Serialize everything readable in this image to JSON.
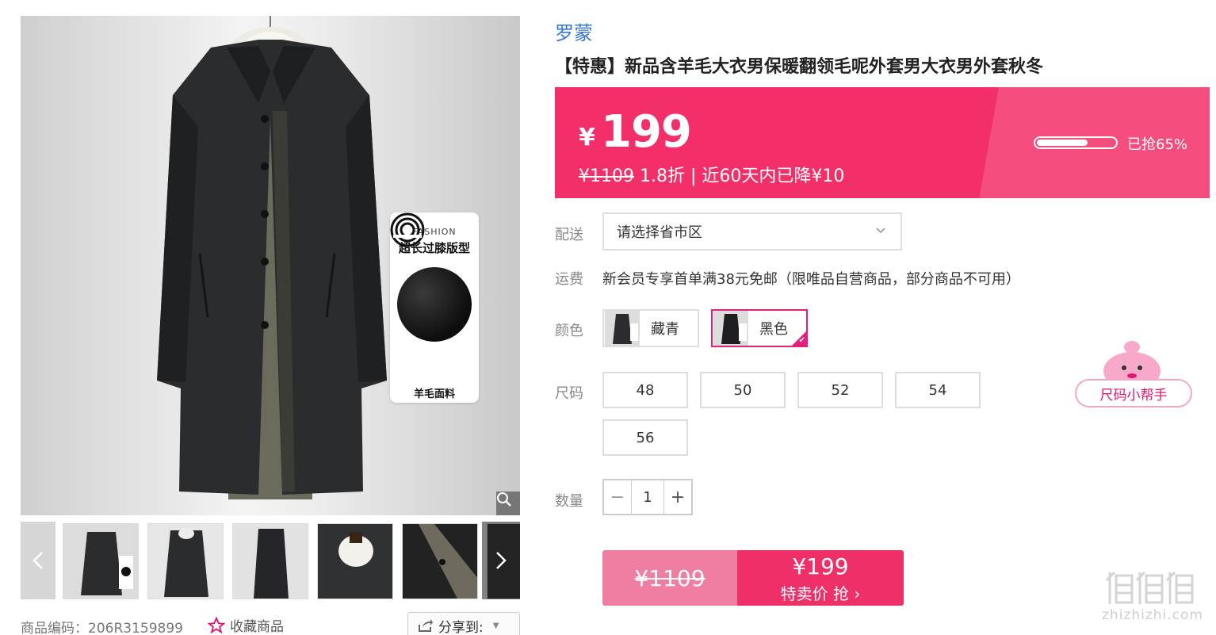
{
  "gallery": {
    "feature_card": {
      "en": "FASHION",
      "cn": "超长过膝版型",
      "wool": "羊毛面料"
    },
    "product_code_label": "商品编码：206R3159899",
    "favorite_label": "收藏商品",
    "share_label": "分享到:"
  },
  "product": {
    "brand": "罗蒙",
    "title": "【特惠】新品含羊毛大衣男保暖翻领毛呢外套男大衣男外套秋冬"
  },
  "price": {
    "currency": "¥",
    "current": "199",
    "original": "¥1109",
    "discount": " 1.8折 | 近60天内已降¥10",
    "sold_label": "已抢65%",
    "sold_fraction": 0.65,
    "accent_color": "#f32f6a"
  },
  "delivery": {
    "label": "配送",
    "placeholder": "请选择省市区"
  },
  "freight": {
    "label": "运费",
    "text": "新会员专享首单满38元免邮（限唯品自营商品，部分商品不可用）"
  },
  "color": {
    "label": "颜色",
    "options": [
      {
        "name": "藏青",
        "selected": false
      },
      {
        "name": "黑色",
        "selected": true
      }
    ]
  },
  "size": {
    "label": "尺码",
    "options": [
      "48",
      "50",
      "52",
      "54",
      "56"
    ],
    "helper_label": "尺码小帮手"
  },
  "quantity": {
    "label": "数量",
    "minus": "−",
    "value": "1",
    "plus": "+"
  },
  "buy": {
    "original": "¥1109",
    "price": "¥199",
    "action": "特卖价 抢 ›"
  },
  "watermark": {
    "text": "zhizhizhi.com"
  }
}
